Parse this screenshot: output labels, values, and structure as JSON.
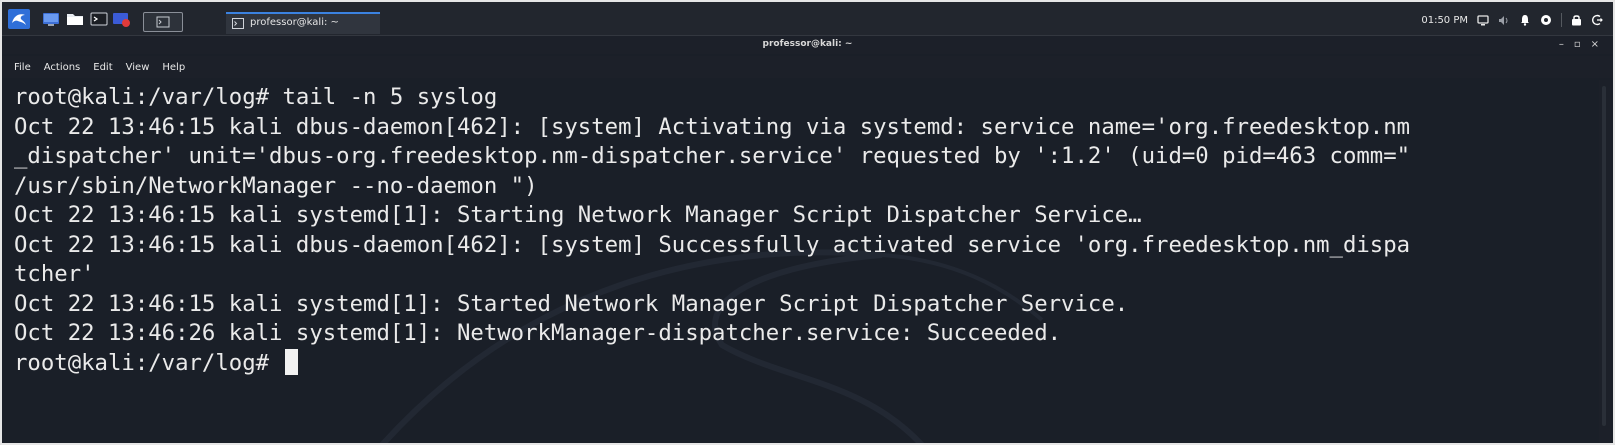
{
  "panel": {
    "launchers": [
      {
        "name": "kali-menu",
        "icon": "kali-dragon-icon"
      },
      {
        "name": "show-desktop",
        "icon": "desktop-icon"
      },
      {
        "name": "file-manager",
        "icon": "folder-icon"
      },
      {
        "name": "terminal",
        "icon": "terminal-icon"
      },
      {
        "name": "firefox",
        "icon": "browser-icon"
      }
    ],
    "task_label": "professor@kali: ~",
    "clock": "01:50 PM",
    "accent": "#3b82e0"
  },
  "window": {
    "title": "professor@kali: ~",
    "controls": {
      "minimize": "–",
      "maximize": "▫",
      "close": "×"
    }
  },
  "menubar": {
    "items": [
      "File",
      "Actions",
      "Edit",
      "View",
      "Help"
    ]
  },
  "terminal": {
    "lines": [
      "root@kali:/var/log# tail -n 5 syslog",
      "Oct 22 13:46:15 kali dbus-daemon[462]: [system] Activating via systemd: service name='org.freedesktop.nm",
      "_dispatcher' unit='dbus-org.freedesktop.nm-dispatcher.service' requested by ':1.2' (uid=0 pid=463 comm=\"",
      "/usr/sbin/NetworkManager --no-daemon \")",
      "Oct 22 13:46:15 kali systemd[1]: Starting Network Manager Script Dispatcher Service…",
      "Oct 22 13:46:15 kali dbus-daemon[462]: [system] Successfully activated service 'org.freedesktop.nm_dispa",
      "tcher'",
      "Oct 22 13:46:15 kali systemd[1]: Started Network Manager Script Dispatcher Service.",
      "Oct 22 13:46:26 kali systemd[1]: NetworkManager-dispatcher.service: Succeeded."
    ],
    "prompt": "root@kali:/var/log# ",
    "background": "#1a1f28",
    "foreground": "#eaeaea"
  }
}
